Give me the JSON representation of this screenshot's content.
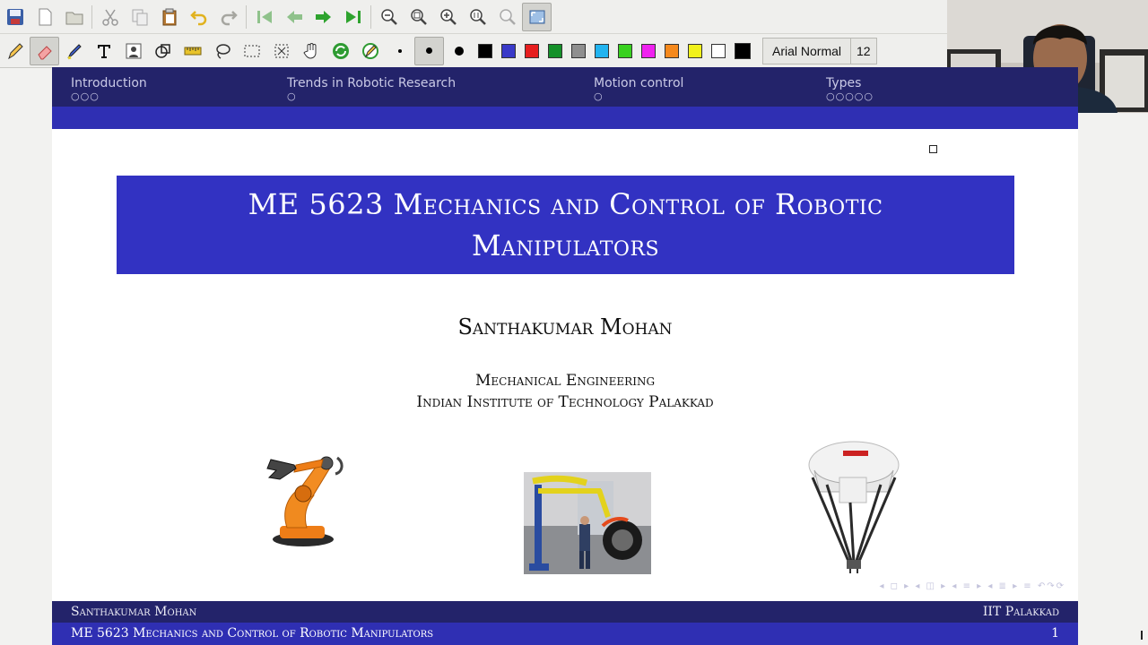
{
  "toolbar_top": {
    "buttons": [
      "save-icon",
      "new-page-icon",
      "open-folder-icon",
      "cut-icon",
      "copy-icon",
      "paste-icon",
      "undo-icon",
      "redo-icon",
      "first-page-icon",
      "previous-page-icon",
      "next-page-icon",
      "last-page-icon",
      "zoom-out-icon",
      "zoom-reset-icon",
      "zoom-in-icon",
      "zoom-fit-width-icon",
      "zoom-fit-page-icon",
      "fullscreen-icon"
    ]
  },
  "toolbar_pen": {
    "font_name": "Arial Normal",
    "font_size": "12",
    "colors": [
      "#000000",
      "#3a3ac8",
      "#e61e1e",
      "#15912a",
      "#8f8f8f",
      "#22b4f0",
      "#39d11f",
      "#ef22ef",
      "#f5891c",
      "#f1f11b",
      "#ffffff",
      "#000000"
    ]
  },
  "slide": {
    "nav": [
      {
        "label": "Introduction",
        "dots": "○○○"
      },
      {
        "label": "Trends in Robotic Research",
        "dots": "○"
      },
      {
        "label": "Motion control",
        "dots": "○"
      },
      {
        "label": "Types",
        "dots": "○○○○○"
      }
    ],
    "title": "ME 5623 Mechanics and Control of Robotic Manipulators",
    "author": "Santhakumar Mohan",
    "department": "Mechanical Engineering",
    "institute": "Indian Institute of Technology Palakkad",
    "figures": [
      "industrial-robot-arm",
      "pneumatic-manipulator",
      "delta-parallel-robot"
    ],
    "footer": {
      "author": "Santhakumar Mohan",
      "institute": "IIT Palakkad",
      "course": "ME 5623 Mechanics and Control of Robotic Manipulators",
      "page": "1"
    }
  },
  "colors": {
    "nav_dark": "#23236a",
    "nav_strip": "#2f2fb3",
    "title_box": "#3232c2"
  }
}
